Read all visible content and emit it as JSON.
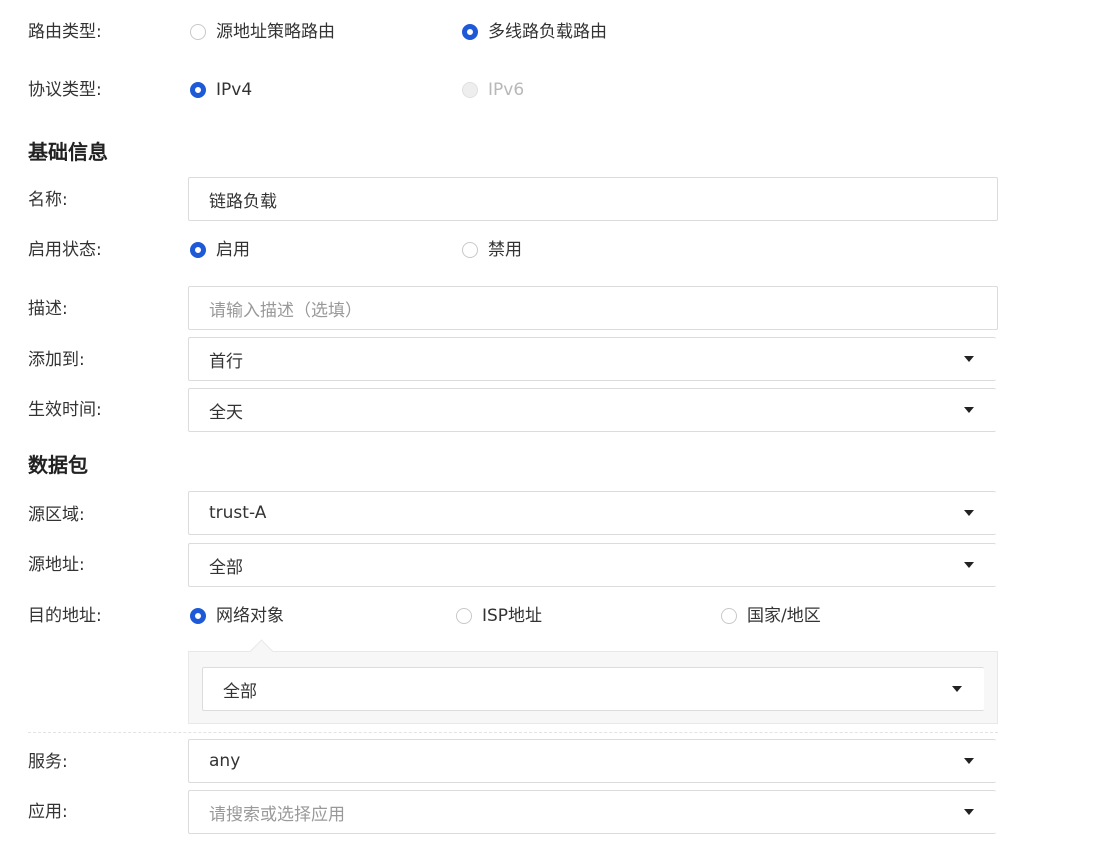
{
  "route_type": {
    "label": "路由类型:",
    "options": [
      {
        "text": "源地址策略路由",
        "checked": false
      },
      {
        "text": "多线路负载路由",
        "checked": true
      }
    ]
  },
  "protocol_type": {
    "label": "协议类型:",
    "options": [
      {
        "text": "IPv4",
        "checked": true,
        "disabled": false
      },
      {
        "text": "IPv6",
        "checked": false,
        "disabled": true
      }
    ]
  },
  "basic_info": {
    "title": "基础信息",
    "name": {
      "label": "名称:",
      "value": "链路负载"
    },
    "status": {
      "label": "启用状态:",
      "options": [
        {
          "text": "启用",
          "checked": true
        },
        {
          "text": "禁用",
          "checked": false
        }
      ]
    },
    "description": {
      "label": "描述:",
      "placeholder": "请输入描述（选填）",
      "value": ""
    },
    "add_to": {
      "label": "添加到:",
      "value": "首行"
    },
    "effective_time": {
      "label": "生效时间:",
      "value": "全天"
    }
  },
  "packet": {
    "title": "数据包",
    "source_zone": {
      "label": "源区域:",
      "value": "trust-A"
    },
    "source_address": {
      "label": "源地址:",
      "value": "全部"
    },
    "destination": {
      "label": "目的地址:",
      "options": [
        {
          "text": "网络对象",
          "checked": true
        },
        {
          "text": "ISP地址",
          "checked": false
        },
        {
          "text": "国家/地区",
          "checked": false
        }
      ],
      "network_object_value": "全部"
    },
    "service": {
      "label": "服务:",
      "value": "any"
    },
    "application": {
      "label": "应用:",
      "placeholder": "请搜索或选择应用",
      "value": ""
    }
  },
  "colors": {
    "accent": "#1e5ad8",
    "border": "#dcdcdc",
    "placeholder": "#999999",
    "disabled": "#b8b8b8"
  }
}
